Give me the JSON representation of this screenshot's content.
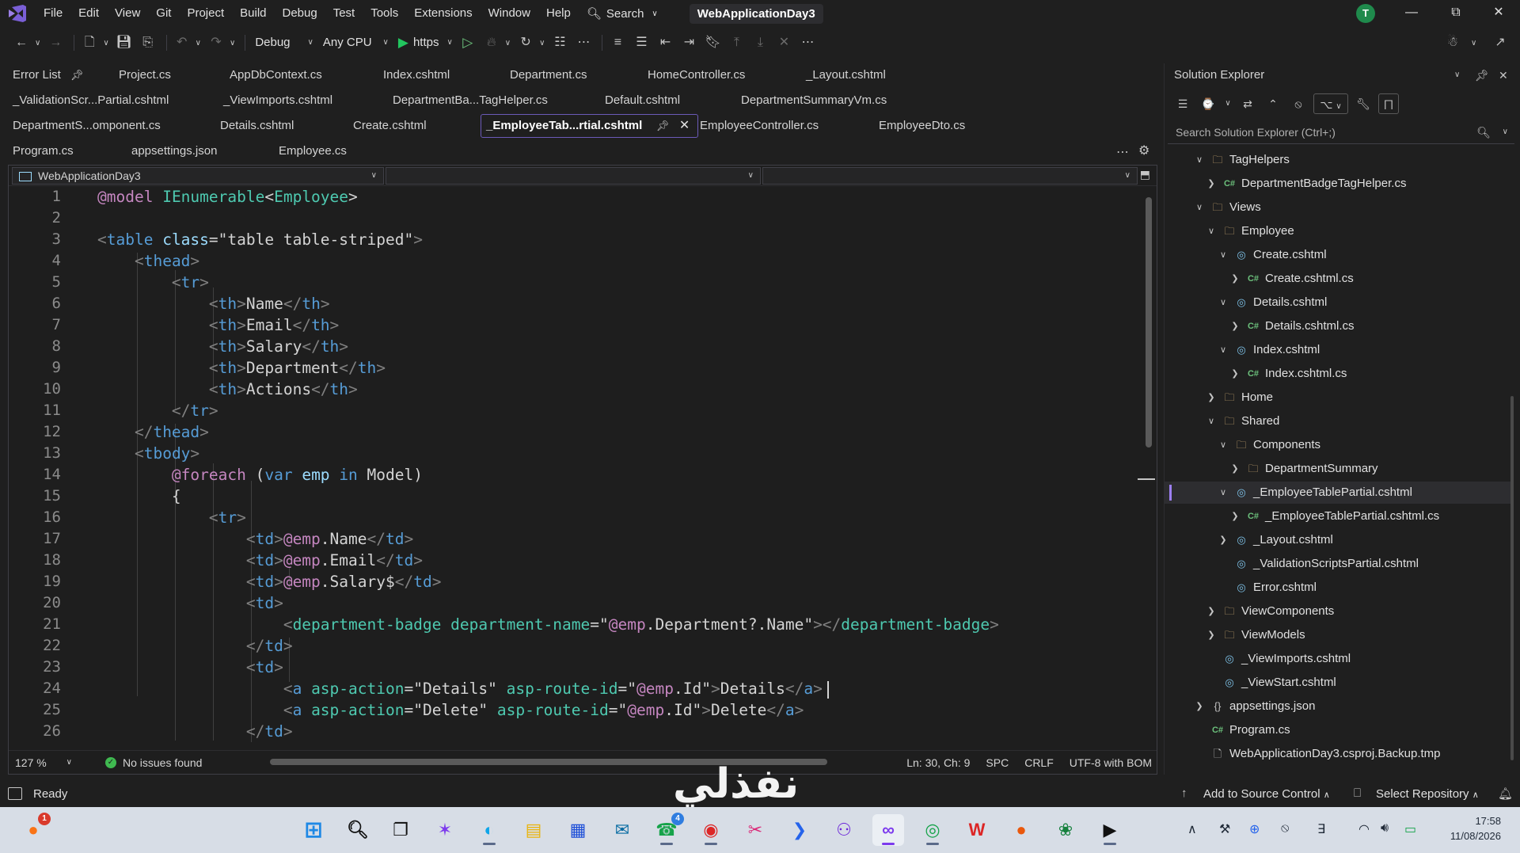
{
  "menubar": {
    "items": [
      "File",
      "Edit",
      "View",
      "Git",
      "Project",
      "Build",
      "Debug",
      "Test",
      "Tools",
      "Extensions",
      "Window",
      "Help"
    ],
    "search_label": "Search",
    "solution_title": "WebApplicationDay3",
    "avatar_initial": "T"
  },
  "toolbar": {
    "configuration": "Debug",
    "platform": "Any CPU",
    "run_profile": "https"
  },
  "tabs": {
    "row1": [
      "Error List",
      "Project.cs",
      "AppDbContext.cs",
      "Index.cshtml",
      "Department.cs",
      "HomeController.cs",
      "_Layout.cshtml"
    ],
    "row2": [
      "_ValidationScr...Partial.cshtml",
      "_ViewImports.cshtml",
      "DepartmentBa...TagHelper.cs",
      "Default.cshtml",
      "DepartmentSummaryVm.cs"
    ],
    "row3": [
      "DepartmentS...omponent.cs",
      "Details.cshtml",
      "Create.cshtml",
      "_EmployeeTab...rtial.cshtml",
      "EmployeeController.cs",
      "EmployeeDto.cs"
    ],
    "row4": [
      "Program.cs",
      "appsettings.json",
      "Employee.cs"
    ],
    "active": "_EmployeeTab...rtial.cshtml"
  },
  "editor": {
    "project_dropdown": "WebApplicationDay3",
    "line_numbers": [
      "1",
      "2",
      "3",
      "4",
      "5",
      "6",
      "7",
      "8",
      "9",
      "10",
      "11",
      "12",
      "13",
      "14",
      "15",
      "16",
      "17",
      "18",
      "19",
      "20",
      "21",
      "22",
      "23",
      "24",
      "25",
      "26"
    ],
    "code": {
      "l1_directive": "@model",
      "l1_type": "IEnumerable",
      "l1_generic": "Employee",
      "l3_tag": "table",
      "l3_attr": "class",
      "l3_value": "\"table table-striped\"",
      "thead": "thead",
      "tr": "tr",
      "th": "th",
      "tbody": "tbody",
      "td": "td",
      "a": "a",
      "th_name": "Name",
      "th_email": "Email",
      "th_salary": "Salary",
      "th_department": "Department",
      "th_actions": "Actions",
      "foreach": "@foreach",
      "var": "var",
      "emp": "emp",
      "in": "in",
      "model": "Model",
      "open_brace": "{",
      "emp_ref": "@emp",
      "name_prop": ".Name",
      "email_prop": ".Email",
      "salary_prop": ".Salary$",
      "badge_tag": "department-badge",
      "badge_attr": "department-name",
      "badge_value_pre": "\"",
      "badge_value_post": ".Department?.Name\"",
      "asp_action": "asp-action",
      "asp_route": "asp-route-id",
      "details_str": "\"Details\"",
      "delete_str": "\"Delete\"",
      "id_prop": ".Id\"",
      "quote": "\"",
      "details_text": "Details",
      "delete_text": "Delete"
    }
  },
  "editor_status": {
    "zoom": "127 %",
    "issues": "No issues found",
    "position": "Ln: 30, Ch: 9",
    "whitespace": "SPC",
    "line_endings": "CRLF",
    "encoding": "UTF-8 with BOM"
  },
  "solution_explorer": {
    "title": "Solution Explorer",
    "search_placeholder": "Search Solution Explorer (Ctrl+;)",
    "nodes": [
      {
        "label": "TagHelpers",
        "icon": "folder-icon",
        "expander": "expanded"
      },
      {
        "label": "DepartmentBadgeTagHelper.cs",
        "icon": "csharp-file-icon",
        "expander": "collapsed"
      },
      {
        "label": "Views",
        "icon": "folder-icon",
        "expander": "expanded"
      },
      {
        "label": "Employee",
        "icon": "folder-icon",
        "expander": "expanded"
      },
      {
        "label": "Create.cshtml",
        "icon": "razor-file-icon",
        "expander": "expanded"
      },
      {
        "label": "Create.cshtml.cs",
        "icon": "csharp-file-icon",
        "expander": "collapsed"
      },
      {
        "label": "Details.cshtml",
        "icon": "razor-file-icon",
        "expander": "expanded"
      },
      {
        "label": "Details.cshtml.cs",
        "icon": "csharp-file-icon",
        "expander": "collapsed"
      },
      {
        "label": "Index.cshtml",
        "icon": "razor-file-icon",
        "expander": "expanded"
      },
      {
        "label": "Index.cshtml.cs",
        "icon": "csharp-file-icon",
        "expander": "collapsed"
      },
      {
        "label": "Home",
        "icon": "folder-icon",
        "expander": "collapsed"
      },
      {
        "label": "Shared",
        "icon": "folder-icon",
        "expander": "expanded"
      },
      {
        "label": "Components",
        "icon": "folder-icon",
        "expander": "expanded"
      },
      {
        "label": "DepartmentSummary",
        "icon": "folder-icon",
        "expander": "collapsed"
      },
      {
        "label": "_EmployeeTablePartial.cshtml",
        "icon": "razor-file-icon",
        "expander": "expanded",
        "selected": true
      },
      {
        "label": "_EmployeeTablePartial.cshtml.cs",
        "icon": "csharp-file-icon",
        "expander": "collapsed"
      },
      {
        "label": "_Layout.cshtml",
        "icon": "razor-file-icon",
        "expander": "collapsed"
      },
      {
        "label": "_ValidationScriptsPartial.cshtml",
        "icon": "razor-file-icon",
        "expander": "none"
      },
      {
        "label": "Error.cshtml",
        "icon": "razor-file-icon",
        "expander": "none"
      },
      {
        "label": "ViewComponents",
        "icon": "folder-icon",
        "expander": "collapsed"
      },
      {
        "label": "ViewModels",
        "icon": "folder-icon",
        "expander": "collapsed"
      },
      {
        "label": "_ViewImports.cshtml",
        "icon": "razor-file-icon",
        "expander": "none"
      },
      {
        "label": "_ViewStart.cshtml",
        "icon": "razor-file-icon",
        "expander": "none"
      },
      {
        "label": "appsettings.json",
        "icon": "json-file-icon",
        "expander": "collapsed"
      },
      {
        "label": "Program.cs",
        "icon": "csharp-file-icon",
        "expander": "none"
      },
      {
        "label": "WebApplicationDay3.csproj.Backup.tmp",
        "icon": "file-icon",
        "expander": "none"
      }
    ]
  },
  "statusbar": {
    "ready": "Ready",
    "source_control": "Add to Source Control",
    "select_repository": "Select Repository"
  },
  "watermark": "نفذلي",
  "taskbar": {
    "whatsapp_badge": "4",
    "notification_badge": "1",
    "clock_time": "17:58",
    "clock_date": "11/08/2026"
  },
  "colors": {
    "accent": "#6b5ab8",
    "selection_bar": "#9d7ff4",
    "run_green": "#22c55e"
  }
}
